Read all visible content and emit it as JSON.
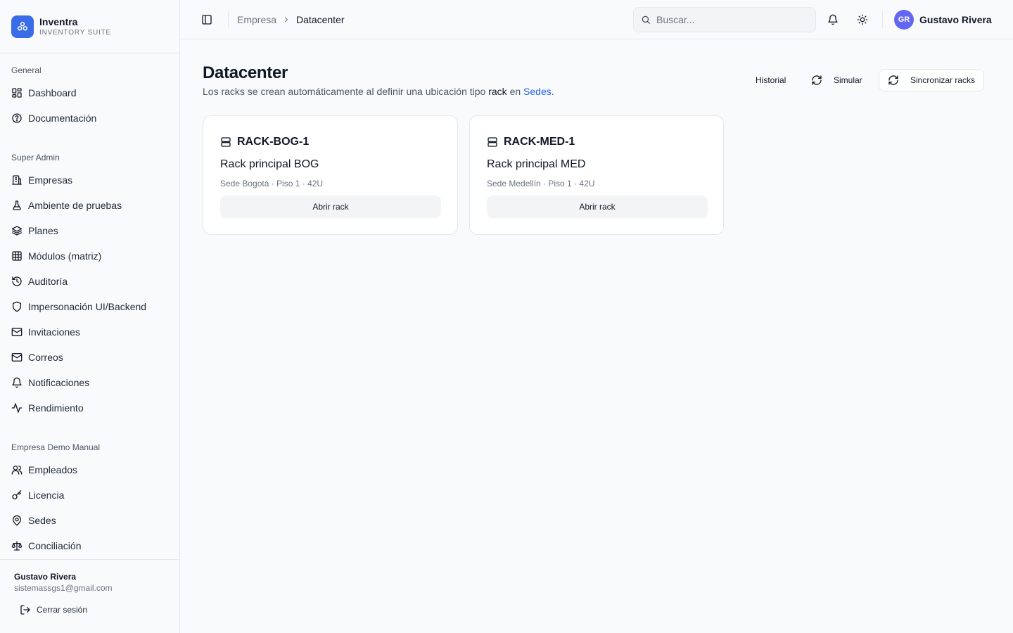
{
  "brand": {
    "name": "Inventra",
    "subtitle": "INVENTORY SUITE",
    "accent": "#3b6ce8"
  },
  "sidebar": {
    "sections": [
      {
        "heading": "General",
        "items": [
          {
            "label": "Dashboard",
            "icon": "dashboard-icon"
          },
          {
            "label": "Documentación",
            "icon": "help-circle-icon"
          }
        ]
      },
      {
        "heading": "Super Admin",
        "items": [
          {
            "label": "Empresas",
            "icon": "building-icon"
          },
          {
            "label": "Ambiente de pruebas",
            "icon": "flask-icon"
          },
          {
            "label": "Planes",
            "icon": "layers-icon"
          },
          {
            "label": "Módulos (matriz)",
            "icon": "grid-table-icon"
          },
          {
            "label": "Auditoría",
            "icon": "history-icon"
          },
          {
            "label": "Impersonación UI/Backend",
            "icon": "shield-icon"
          },
          {
            "label": "Invitaciones",
            "icon": "mail-icon"
          },
          {
            "label": "Correos",
            "icon": "mail-icon"
          },
          {
            "label": "Notificaciones",
            "icon": "bell-icon"
          },
          {
            "label": "Rendimiento",
            "icon": "activity-icon"
          }
        ]
      },
      {
        "heading": "Empresa Demo Manual",
        "items": [
          {
            "label": "Empleados",
            "icon": "users-icon"
          },
          {
            "label": "Licencia",
            "icon": "key-icon"
          },
          {
            "label": "Sedes",
            "icon": "map-pin-icon"
          },
          {
            "label": "Conciliación",
            "icon": "scale-icon"
          }
        ]
      }
    ],
    "footer": {
      "user_name": "Gustavo Rivera",
      "user_email": "sistemassgs1@gmail.com",
      "logout_label": "Cerrar sesión"
    }
  },
  "topbar": {
    "breadcrumb": [
      "Empresa",
      "Datacenter"
    ],
    "search_placeholder": "Buscar...",
    "avatar_initials": "GR",
    "avatar_color": "#6366f1",
    "user_name": "Gustavo Rivera"
  },
  "main": {
    "title": "Datacenter",
    "description": {
      "before": "Los racks se crean automáticamente al definir una ubicación tipo ",
      "strong": "rack",
      "middle": " en ",
      "link": "Sedes",
      "after": "."
    },
    "actions": {
      "history": "Historial",
      "simulate": "Simular",
      "sync": "Sincronizar racks"
    },
    "racks": [
      {
        "code": "RACK-BOG-1",
        "name": "Rack principal BOG",
        "meta": "Sede Bogotá · Piso 1 · 42U",
        "button": "Abrir rack"
      },
      {
        "code": "RACK-MED-1",
        "name": "Rack principal MED",
        "meta": "Sede Medellín · Piso 1 · 42U",
        "button": "Abrir rack"
      }
    ]
  }
}
